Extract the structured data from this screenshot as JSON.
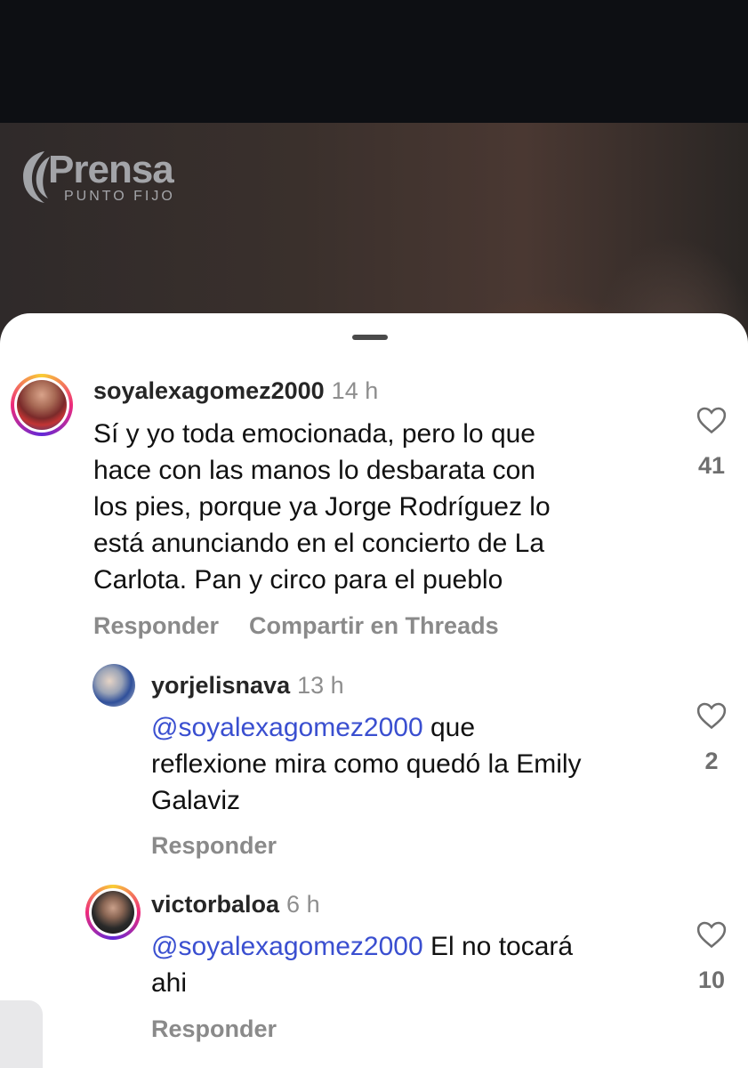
{
  "video": {
    "logo_word": "Prensa",
    "logo_sub": "PUNTO FIJO"
  },
  "comments": [
    {
      "username": "soyalexagomez2000",
      "time": "14 h",
      "text_lines": [
        "Sí y yo toda emocionada, pero lo que",
        "hace con las manos lo desbarata con",
        "los pies, porque ya Jorge Rodríguez lo",
        "está anunciando en el concierto de La",
        "Carlota. Pan y circo para el pueblo"
      ],
      "actions": [
        "Responder",
        "Compartir en Threads"
      ],
      "likes": "41",
      "icon": "heart-outline-icon"
    },
    {
      "username": "yorjelisnava",
      "time": "13 h",
      "mention": "@soyalexagomez2000",
      "text_after_mention": " que",
      "text_lines": [
        "reflexione mira como quedó la Emily",
        "Galaviz"
      ],
      "actions": [
        "Responder"
      ],
      "likes": "2",
      "icon": "heart-outline-icon"
    },
    {
      "username": "victorbaloa",
      "time": "6 h",
      "mention": "@soyalexagomez2000",
      "text_after_mention": " El no tocará",
      "text_lines": [
        "ahi"
      ],
      "actions": [
        "Responder"
      ],
      "likes": "10",
      "icon": "heart-outline-icon"
    }
  ],
  "colors": {
    "mention": "#3a4fd0",
    "story_ring": "#ee2a7b",
    "secondary_text": "#8e8e8e"
  }
}
